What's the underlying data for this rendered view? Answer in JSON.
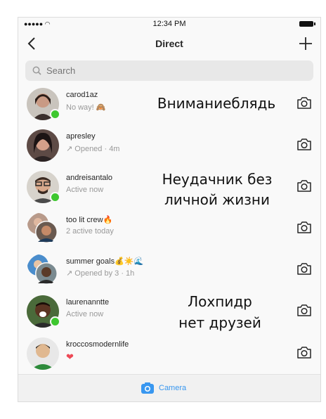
{
  "status": {
    "time": "12:34 PM",
    "signal": "●●●●● ◠"
  },
  "header": {
    "title": "Direct"
  },
  "search": {
    "placeholder": "Search"
  },
  "threads": [
    {
      "username": "carod1az",
      "subtitle": "No way! 🙈",
      "online": true
    },
    {
      "username": "apresley",
      "subtitle": "↗ Opened · 4m",
      "online": false
    },
    {
      "username": "andreisantalo",
      "subtitle": "Active now",
      "online": true
    },
    {
      "username": "too lit crew🔥",
      "subtitle": "2 active today",
      "online": false
    },
    {
      "username": "summer goals💰☀️🌊",
      "subtitle": "↗ Opened by 3 · 1h",
      "online": false
    },
    {
      "username": "laurenanntte",
      "subtitle": "Active now",
      "online": true
    },
    {
      "username": "kroccosmodernlife",
      "subtitle": "❤",
      "online": false
    }
  ],
  "overlays": {
    "line1": "Вниманиеблядь",
    "line2a": "Неудачник без",
    "line2b": "личной жизни",
    "line3a": "Лохпидр",
    "line3b": "нет друзей"
  },
  "bottom": {
    "camera_label": "Camera"
  },
  "colors": {
    "online": "#3ec72f",
    "accent": "#3897f0",
    "heart": "#ed4956"
  }
}
